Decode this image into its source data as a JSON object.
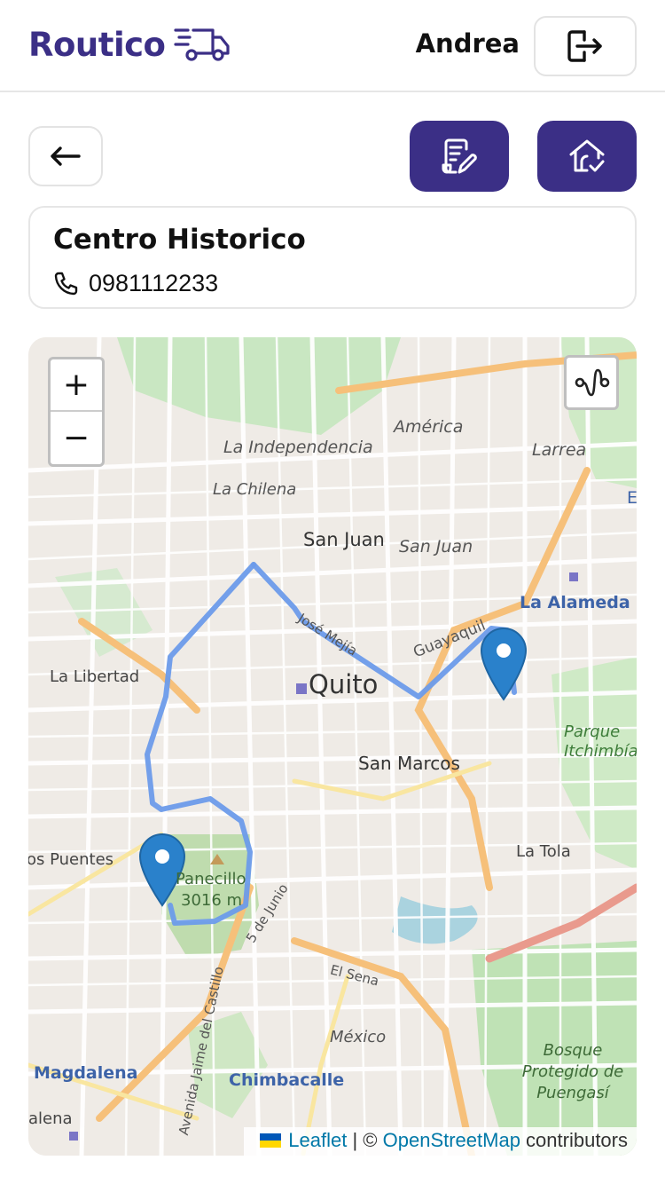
{
  "header": {
    "brand": "Routico",
    "user": "Andrea"
  },
  "location": {
    "name": "Centro Historico",
    "phone": "0981112233"
  },
  "map": {
    "zoom_in": "+",
    "zoom_out": "−",
    "labels": {
      "america": "América",
      "la_independencia": "La Independencia",
      "larrea": "Larrea",
      "la_chilena": "La Chilena",
      "san_juan_1": "San Juan",
      "san_juan_2": "San Juan",
      "la_alameda": "La Alameda",
      "la_libertad": "La Libertad",
      "quito": "Quito",
      "jose_mejia": "José Mejía",
      "guayaquil": "Guayaquil",
      "parque_itchimbia": "Parque Itchimbía",
      "san_marcos": "San Marcos",
      "dos_puentes": "os Puentes",
      "panecillo": "Panecillo",
      "panecillo_alt": "3016 m",
      "la_tola": "La Tola",
      "cinco_junio": "5 de Junio",
      "el_sena": "El Sena",
      "av_jaime": "Avenida Jaime del Castillo",
      "mexico": "México",
      "bosque": "Bosque Protegido de Puengasí",
      "magdalena": "Magdalena",
      "chimbacalle": "Chimbacalle",
      "alena": "alena",
      "edge_e": "E"
    },
    "attribution": {
      "leaflet": "Leaflet",
      "separator": " | © ",
      "osm": "OpenStreetMap",
      "suffix": " contributors"
    }
  },
  "colors": {
    "brand": "#3b2f86",
    "route": "#6b9bea",
    "marker": "#2a81cb"
  },
  "icons": {
    "brand_truck": "truck-icon",
    "logout": "logout-icon",
    "back": "arrow-left-icon",
    "edit": "document-edit-icon",
    "home": "home-check-icon",
    "phone": "phone-icon",
    "route_toggle": "route-icon",
    "marker": "map-pin-icon"
  }
}
